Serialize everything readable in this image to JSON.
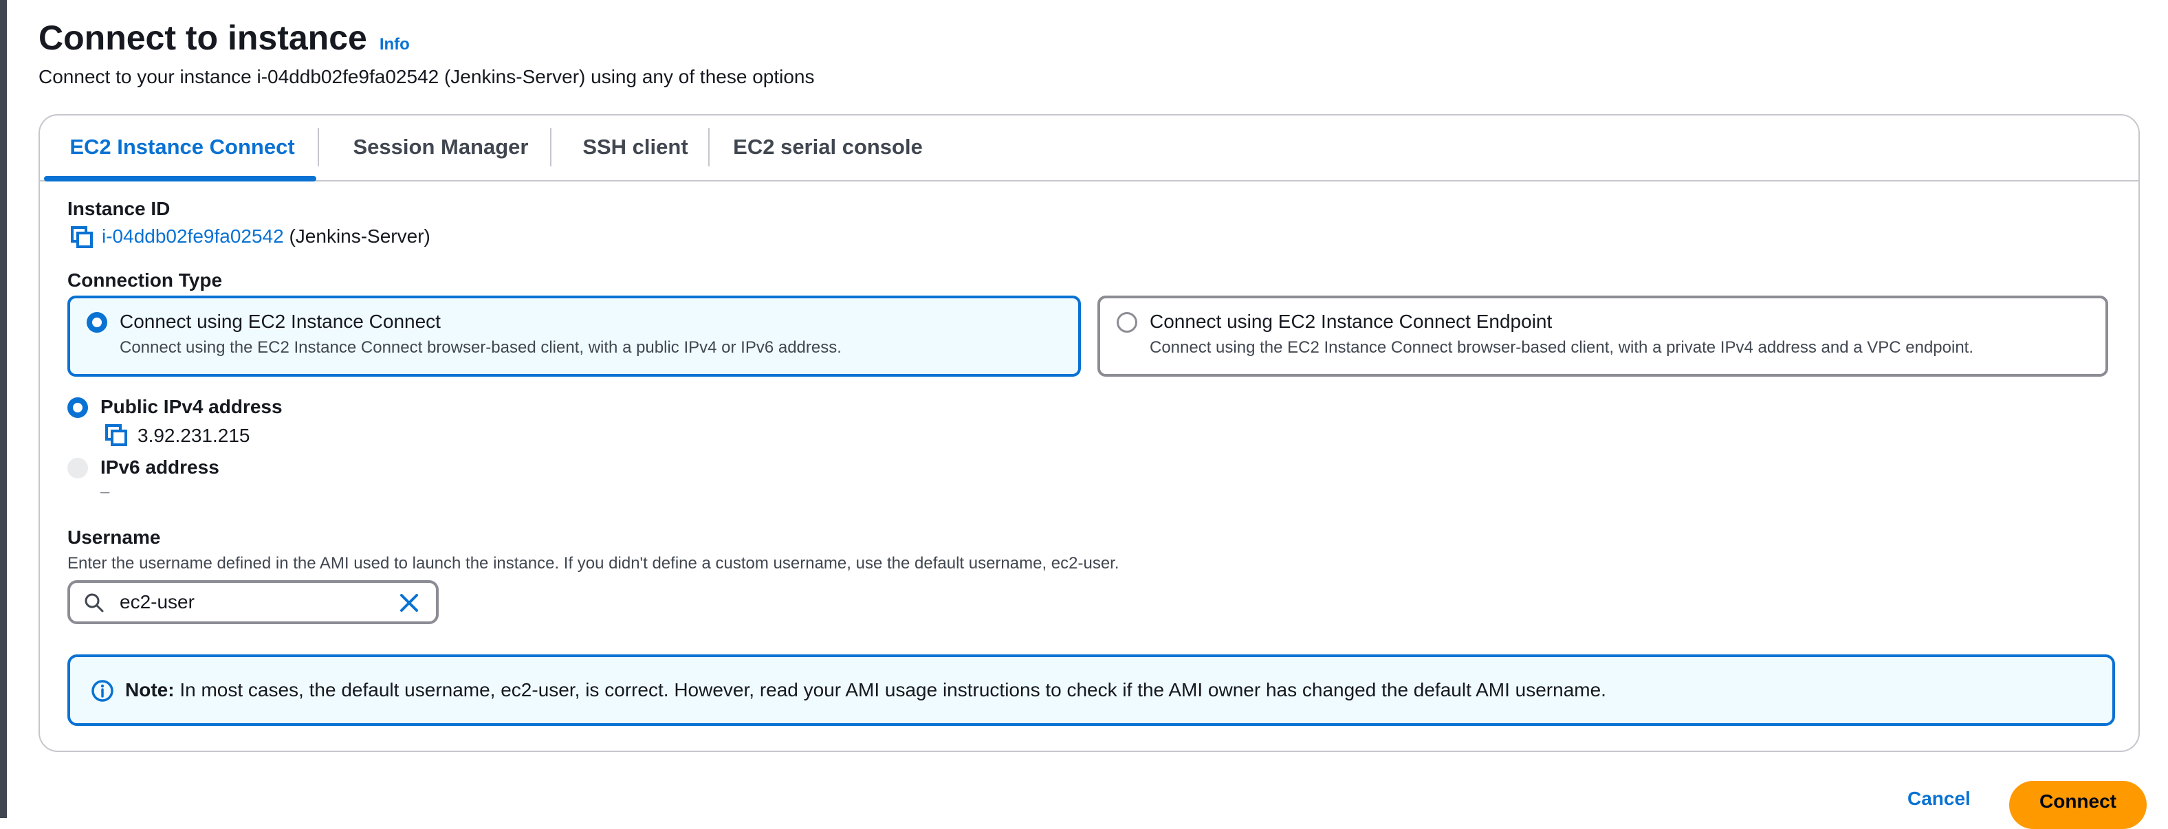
{
  "header": {
    "title": "Connect to instance",
    "info_label": "Info",
    "subtitle": "Connect to your instance i-04ddb02fe9fa02542 (Jenkins-Server) using any of these options"
  },
  "tabs": [
    {
      "label": "EC2 Instance Connect",
      "active": true
    },
    {
      "label": "Session Manager",
      "active": false
    },
    {
      "label": "SSH client",
      "active": false
    },
    {
      "label": "EC2 serial console",
      "active": false
    }
  ],
  "instance": {
    "label": "Instance ID",
    "id": "i-04ddb02fe9fa02542",
    "name": "(Jenkins-Server)"
  },
  "connection_type": {
    "label": "Connection Type",
    "options": [
      {
        "title": "Connect using EC2 Instance Connect",
        "description": "Connect using the EC2 Instance Connect browser-based client, with a public IPv4 or IPv6 address.",
        "selected": true
      },
      {
        "title": "Connect using EC2 Instance Connect Endpoint",
        "description": "Connect using the EC2 Instance Connect browser-based client, with a private IPv4 address and a VPC endpoint.",
        "selected": false
      }
    ]
  },
  "address": {
    "ipv4_label": "Public IPv4 address",
    "ipv4_value": "3.92.231.215",
    "ipv6_label": "IPv6 address",
    "ipv6_value": "–"
  },
  "username": {
    "label": "Username",
    "description": "Enter the username defined in the AMI used to launch the instance. If you didn't define a custom username, use the default username, ec2-user.",
    "value": "ec2-user"
  },
  "note": {
    "prefix": "Note:",
    "text": "In most cases, the default username, ec2-user, is correct. However, read your AMI usage instructions to check if the AMI owner has changed the default AMI username."
  },
  "footer": {
    "cancel_label": "Cancel",
    "connect_label": "Connect"
  },
  "colors": {
    "accent": "#0972d3",
    "primary_button": "#ff9900",
    "selected_bg": "#f0fbff"
  }
}
